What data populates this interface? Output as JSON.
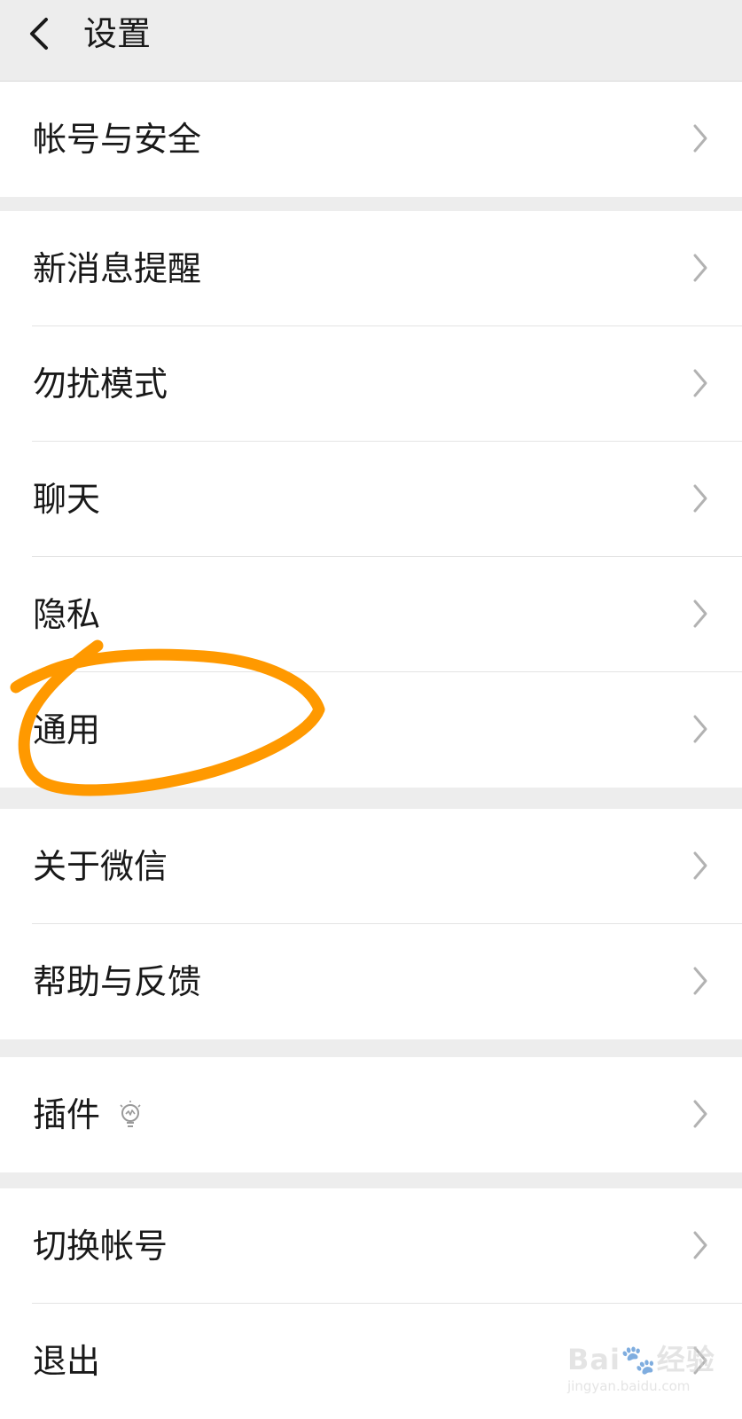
{
  "header": {
    "title": "设置"
  },
  "groups": [
    {
      "items": [
        {
          "label": "帐号与安全"
        }
      ]
    },
    {
      "items": [
        {
          "label": "新消息提醒"
        },
        {
          "label": "勿扰模式"
        },
        {
          "label": "聊天"
        },
        {
          "label": "隐私"
        },
        {
          "label": "通用"
        }
      ]
    },
    {
      "items": [
        {
          "label": "关于微信"
        },
        {
          "label": "帮助与反馈"
        }
      ]
    },
    {
      "items": [
        {
          "label": "插件"
        }
      ]
    },
    {
      "items": [
        {
          "label": "切换帐号"
        },
        {
          "label": "退出"
        }
      ]
    }
  ],
  "watermark": {
    "text": "Bai🐾经验",
    "url": "jingyan.baidu.com"
  },
  "colors": {
    "page_background": "#ededed",
    "row_background": "#ffffff",
    "annotation_orange": "#ff9900",
    "chevron": "#b2b2b2"
  },
  "icons": {
    "back": "chevron-left-icon",
    "row_arrow": "chevron-right-icon",
    "plugin": "lightbulb-icon"
  }
}
